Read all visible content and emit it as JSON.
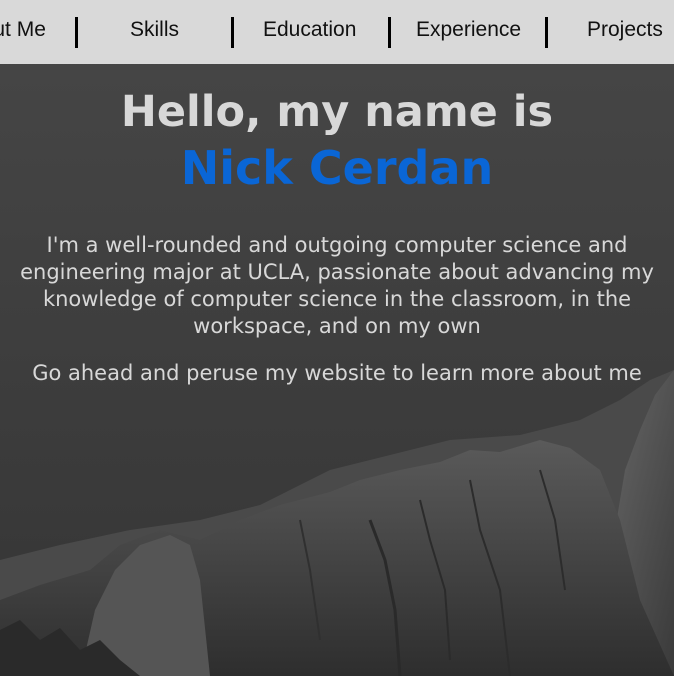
{
  "nav": {
    "items": [
      {
        "label": "About Me"
      },
      {
        "label": "Skills"
      },
      {
        "label": "Education"
      },
      {
        "label": "Experience"
      },
      {
        "label": "Projects"
      }
    ]
  },
  "hero": {
    "greeting": "Hello, my name is",
    "name": "Nick Cerdan",
    "intro": "I'm a well-rounded and outgoing computer science and engineering major at UCLA, passionate about advancing my knowledge of computer science in the classroom, in the workspace, and on my own",
    "cta": "Go ahead and peruse my website to learn more about me"
  },
  "colors": {
    "nav_background": "#d9d9d9",
    "nav_text": "#111111",
    "hero_text": "#d8d8d8",
    "name_accent": "#0a66d6",
    "background_dark": "#3a3a3a"
  }
}
